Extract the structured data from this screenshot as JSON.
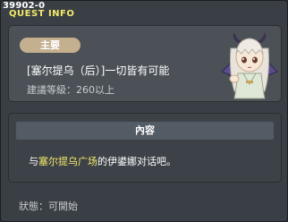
{
  "window": {
    "quest_id": "39902-0",
    "title": "QUEST INFO"
  },
  "quest": {
    "tag": "主要",
    "title": "[塞尔提乌（后）]一切皆有可能",
    "level_requirement": "建議等級：260以上",
    "npc_icon": "npc-girl-portrait"
  },
  "content": {
    "header": "內容",
    "text_prefix": "与",
    "text_highlight": "塞尔提乌广场",
    "text_suffix": "的伊鍙娜对话吧。"
  },
  "status": {
    "text": "狀態：可開始"
  },
  "colors": {
    "background": "#3a3f45",
    "panel": "#4b5157",
    "title_yellow": "#f3e96a",
    "tag_beige": "#c4b08f",
    "highlight": "#f3e96a"
  }
}
